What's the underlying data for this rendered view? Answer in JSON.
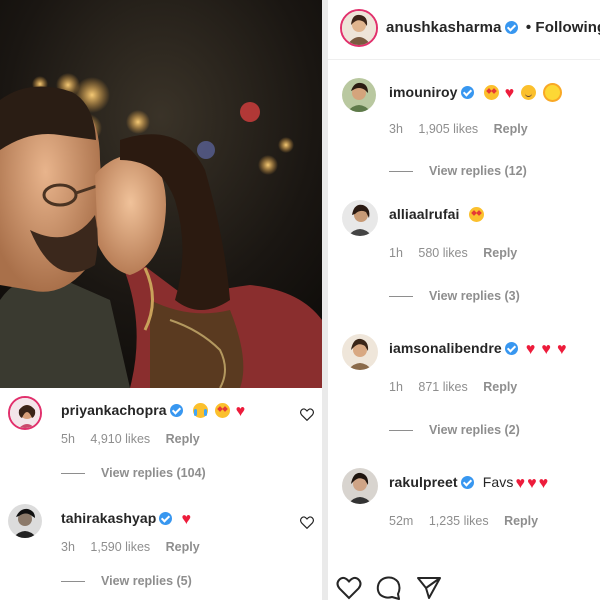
{
  "left": {
    "photo": {
      "alt_subject": "couple-photo"
    },
    "comments": [
      {
        "username": "priyankachopra",
        "verified": true,
        "text": "",
        "emojis": [
          "tears-of-joy",
          "star-struck",
          "heart"
        ],
        "time": "5h",
        "likes": "4,910 likes",
        "reply": "Reply",
        "view_replies": "View replies (104)"
      },
      {
        "username": "tahirakashyap",
        "verified": true,
        "text": "",
        "emojis": [
          "heart"
        ],
        "time": "3h",
        "likes": "1,590 likes",
        "reply": "Reply",
        "view_replies": "View replies (5)"
      }
    ]
  },
  "right": {
    "header": {
      "username": "anushkasharma",
      "verified": true,
      "follow_status": "• Following"
    },
    "comments": [
      {
        "username": "imouniroy",
        "verified": true,
        "text": "",
        "emojis": [
          "star-struck",
          "heart",
          "smile",
          "sun"
        ],
        "time": "3h",
        "likes": "1,905 likes",
        "reply": "Reply",
        "view_replies": "View replies (12)"
      },
      {
        "username": "alliaalrufai",
        "verified": false,
        "text": "",
        "emojis": [
          "star-struck"
        ],
        "time": "1h",
        "likes": "580 likes",
        "reply": "Reply",
        "view_replies": "View replies (3)"
      },
      {
        "username": "iamsonalibendre",
        "verified": true,
        "text": "",
        "emojis": [
          "sparkling-heart",
          "sparkling-heart",
          "sparkling-heart"
        ],
        "time": "1h",
        "likes": "871 likes",
        "reply": "Reply",
        "view_replies": "View replies (2)"
      },
      {
        "username": "rakulpreet",
        "verified": true,
        "text": "Favs",
        "emojis": [
          "heart",
          "heart",
          "heart"
        ],
        "time": "52m",
        "likes": "1,235 likes",
        "reply": "Reply",
        "view_replies": ""
      }
    ],
    "actions": [
      "like-icon",
      "comment-icon",
      "share-icon"
    ]
  },
  "colors": {
    "verified": "#3897f0",
    "heart": "#ed1c3b",
    "muted": "#8e8e8e",
    "text": "#262626"
  }
}
